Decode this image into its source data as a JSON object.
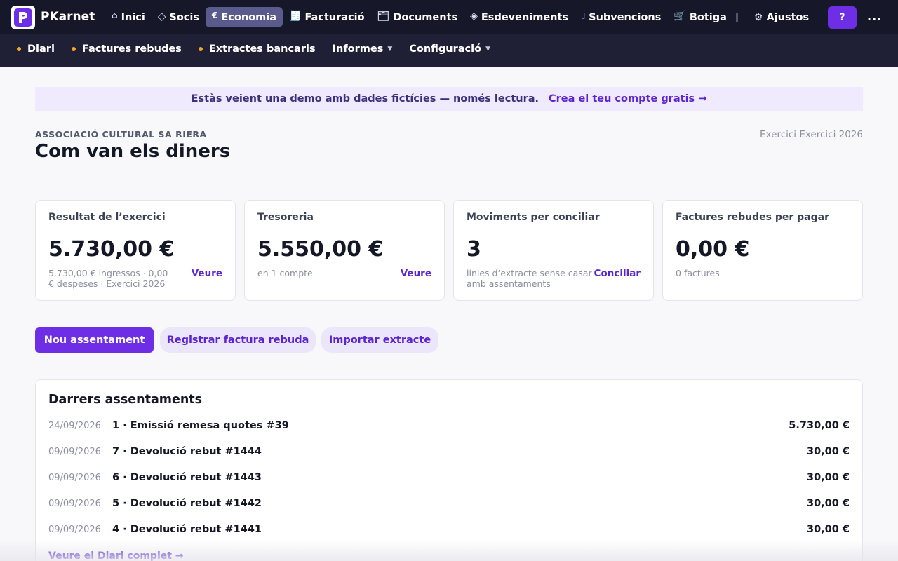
{
  "app": {
    "name": "PKarnet",
    "logo_letter": "P"
  },
  "topnav": {
    "items": [
      {
        "icon": "⌂",
        "icon_name": "home-icon",
        "label": "Inici",
        "active": false
      },
      {
        "icon": "◇",
        "icon_name": "diamond-icon",
        "label": "Socis",
        "active": false
      },
      {
        "icon": "€",
        "icon_name": "euro-icon",
        "label": "Economia",
        "active": true
      },
      {
        "icon": "🧾",
        "icon_name": "receipt-icon",
        "label": "Facturació",
        "active": false
      },
      {
        "icon": "🗂",
        "icon_name": "folder-icon",
        "label": "Documents",
        "active": false
      },
      {
        "icon": "◈",
        "icon_name": "event-diamond-icon",
        "label": "Esdeveniments",
        "active": false
      },
      {
        "icon": "▯",
        "icon_name": "grant-icon",
        "label": "Subvencions",
        "active": false
      },
      {
        "icon": "🛒",
        "icon_name": "cart-icon",
        "label": "Botiga",
        "active": false
      }
    ],
    "settings": {
      "icon": "⚙",
      "label": "Ajustos"
    },
    "help_label": "?",
    "more_label": "..."
  },
  "subnav": {
    "items": [
      {
        "label": "Diari",
        "dot": true,
        "caret": false
      },
      {
        "label": "Factures rebudes",
        "dot": true,
        "caret": false
      },
      {
        "label": "Extractes bancaris",
        "dot": true,
        "caret": false
      },
      {
        "label": "Informes",
        "dot": false,
        "caret": true
      },
      {
        "label": "Configuració",
        "dot": false,
        "caret": true
      }
    ]
  },
  "banner": {
    "text": "Estàs veient una demo amb dades fictícies — només lectura.",
    "link": "Crea el teu compte gratis →"
  },
  "header": {
    "org": "ASSOCIACIÓ CULTURAL SA RIERA",
    "title": "Com van els diners",
    "exercise": "Exercici Exercici 2026"
  },
  "cards": [
    {
      "title": "Resultat de l’exercici",
      "value": "5.730,00 €",
      "sub": "5.730,00 € ingressos · 0,00 € despeses · Exercici 2026",
      "link": "Veure"
    },
    {
      "title": "Tresoreria",
      "value": "5.550,00 €",
      "sub": "en 1 compte",
      "link": "Veure"
    },
    {
      "title": "Moviments per conciliar",
      "value": "3",
      "sub": "línies d’extracte sense casar amb assentaments",
      "link": "Conciliar"
    },
    {
      "title": "Factures rebudes per pagar",
      "value": "0,00 €",
      "sub": "0 factures",
      "link": ""
    }
  ],
  "actions": {
    "primary": "Nou assentament",
    "register_invoice": "Registrar factura rebuda",
    "import_statement": "Importar extracte"
  },
  "entries": {
    "title": "Darrers assentaments",
    "rows": [
      {
        "date": "24/09/2026",
        "desc": "1 · Emissió remesa quotes #39",
        "amount": "5.730,00 €"
      },
      {
        "date": "09/09/2026",
        "desc": "7 · Devolució rebut #1444",
        "amount": "30,00 €"
      },
      {
        "date": "09/09/2026",
        "desc": "6 · Devolució rebut #1443",
        "amount": "30,00 €"
      },
      {
        "date": "09/09/2026",
        "desc": "5 · Devolució rebut #1442",
        "amount": "30,00 €"
      },
      {
        "date": "09/09/2026",
        "desc": "4 · Devolució rebut #1441",
        "amount": "30,00 €"
      }
    ],
    "link": "Veure el Diari complet →"
  },
  "colors": {
    "accent": "#6d2ee6",
    "link": "#5a24d0",
    "topbar": "#17172a",
    "subbar": "#1f2035",
    "dot": "#f5a623"
  }
}
